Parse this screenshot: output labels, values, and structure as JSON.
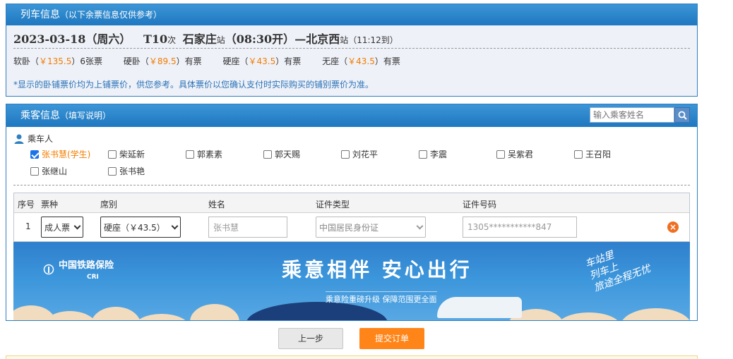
{
  "train_panel": {
    "title": "列车信息",
    "subtitle": "（以下余票信息仅供参考）",
    "date": "2023-03-18（周六）",
    "train_no": "T10",
    "train_suffix": "次",
    "from_station": "石家庄",
    "station_word": "站",
    "depart": "（08:30开）",
    "dash": "—",
    "to_station": "北京西",
    "arrive": "（11:12到）",
    "prices": [
      {
        "seat": "软卧",
        "amount": "￥135.5",
        "status": "6张票"
      },
      {
        "seat": "硬卧",
        "amount": "￥89.5",
        "status": "有票"
      },
      {
        "seat": "硬座",
        "amount": "￥43.5",
        "status": "有票"
      },
      {
        "seat": "无座",
        "amount": "￥43.5",
        "status": "有票"
      }
    ],
    "note": "*显示的卧铺票价均为上铺票价，供您参考。具体票价以您确认支付时实际购买的铺别票价为准。"
  },
  "passenger_panel": {
    "title": "乘客信息",
    "subtitle": "（填写说明）",
    "search_placeholder": "输入乘客姓名",
    "passengers_label": "乘车人",
    "passengers": [
      {
        "name": "张书慧(学生)",
        "checked": true
      },
      {
        "name": "柴延新",
        "checked": false
      },
      {
        "name": "郭素素",
        "checked": false
      },
      {
        "name": "郭天赐",
        "checked": false
      },
      {
        "name": "刘花平",
        "checked": false
      },
      {
        "name": "李震",
        "checked": false
      },
      {
        "name": "吴紫君",
        "checked": false
      },
      {
        "name": "王召阳",
        "checked": false
      },
      {
        "name": "张继山",
        "checked": false
      },
      {
        "name": "张书艳",
        "checked": false
      }
    ],
    "table_headers": {
      "no": "序号",
      "ticket_type": "票种",
      "seat": "席别",
      "name": "姓名",
      "id_type": "证件类型",
      "id_no": "证件号码"
    },
    "rows": [
      {
        "no": "1",
        "ticket_type": "成人票",
        "seat": "硬座（￥43.5）",
        "name": "张书慧",
        "id_type": "中国居民身份证",
        "id_no": "1305***********847"
      }
    ],
    "banner": {
      "logo": "中国铁路保险",
      "logo_sub": "CRI",
      "slogan": "乘意相伴 安心出行",
      "tagline": "乘意险重磅升级 保障范围更全面",
      "script_lines": [
        "车站里",
        "列车上",
        "旅途全程无忧"
      ]
    }
  },
  "buttons": {
    "prev": "上一步",
    "submit": "提交订单"
  },
  "colors": {
    "header_blue": "#1f78c0",
    "accent_orange": "#f37c00",
    "note_blue": "#2b73b7"
  }
}
